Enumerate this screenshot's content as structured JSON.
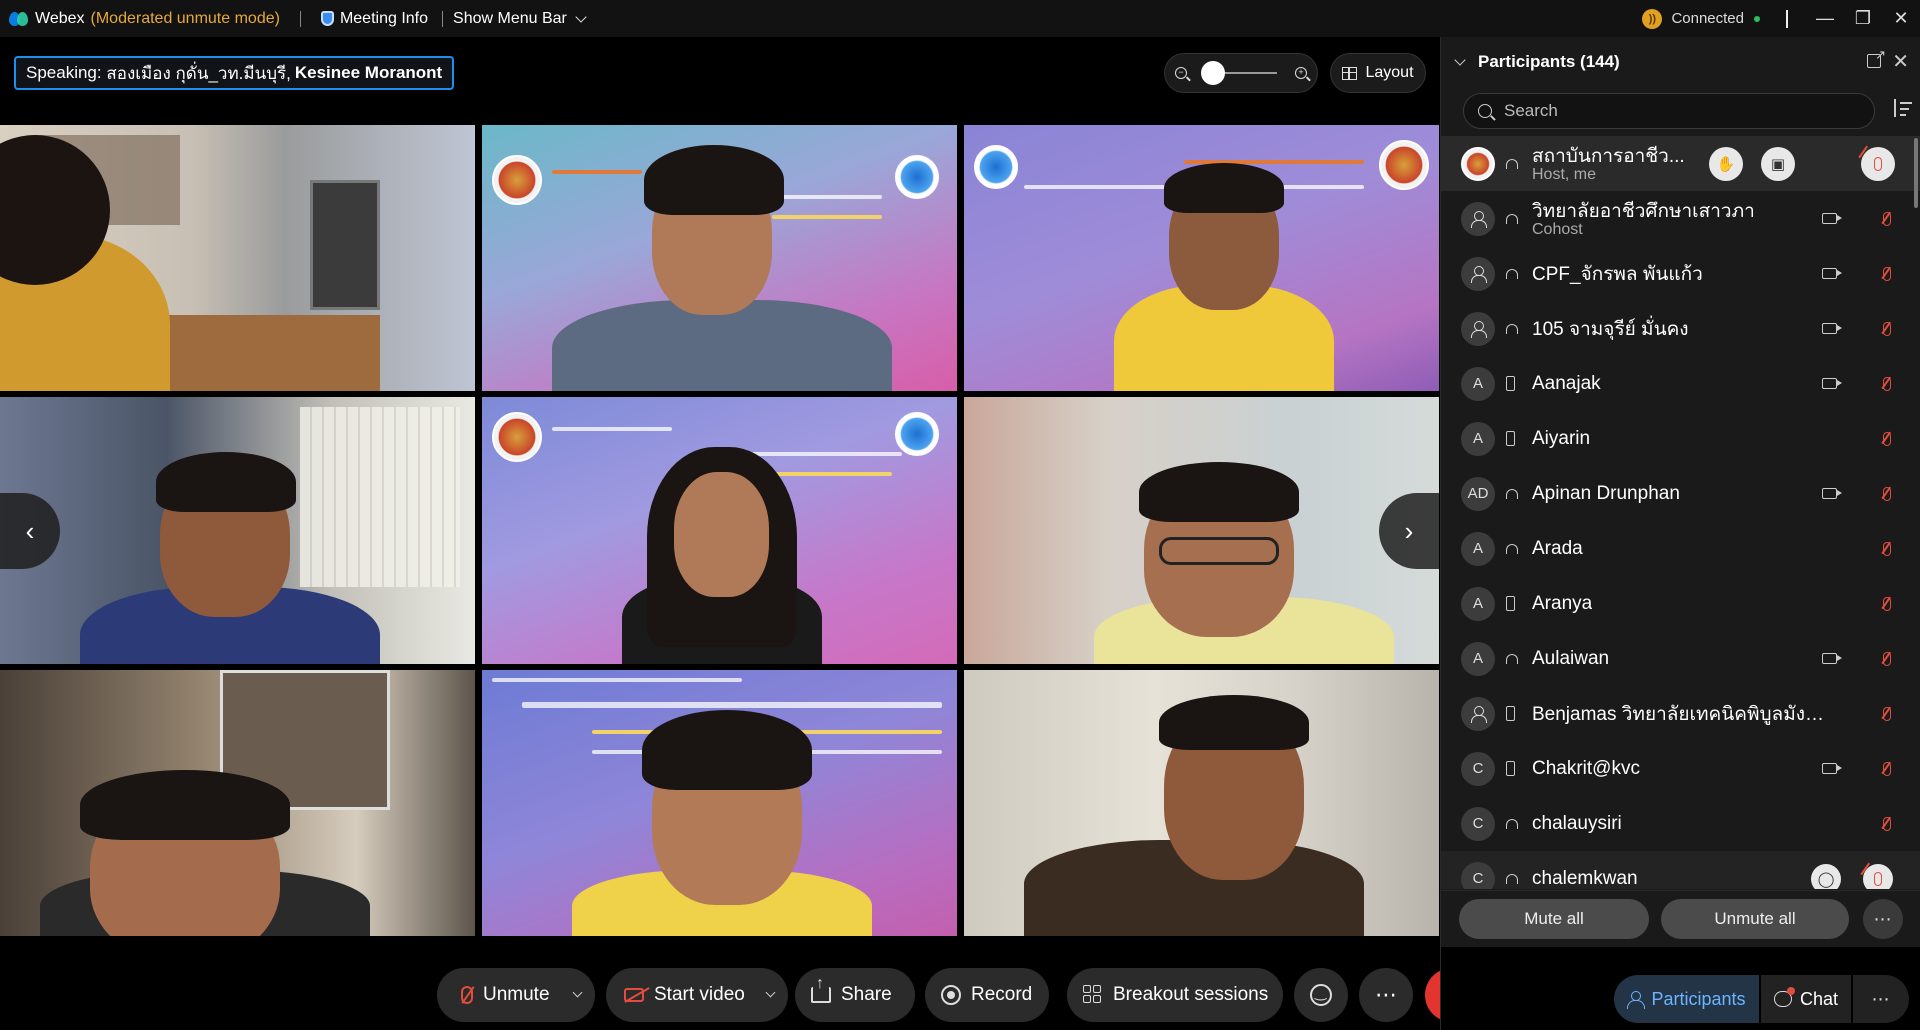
{
  "titlebar": {
    "app_name": "Webex",
    "mode": "(Moderated unmute mode)",
    "meeting_info": "Meeting Info",
    "menu_bar": "Show Menu Bar",
    "status": "Connected",
    "accent": "#e5a93b"
  },
  "speaking": {
    "prefix": "Speaking:",
    "names": "สองเมือง กุดั่น_วท.มีนบุรี,",
    "bold_name": "Kesinee Moranont"
  },
  "layout_button": "Layout",
  "controls": {
    "unmute": "Unmute",
    "start_video": "Start video",
    "share": "Share",
    "record": "Record",
    "breakout": "Breakout sessions",
    "more": "⋯",
    "leave": "✕"
  },
  "participants": {
    "title": "Participants (144)",
    "search_placeholder": "Search",
    "rows": [
      {
        "name": "สถาบันการอาชีว...",
        "role": "Host, me",
        "avatar": ""
      },
      {
        "name": "วิทยาลัยอาชีวศึกษาเสาวภา",
        "role": "Cohost",
        "avatar": ""
      },
      {
        "name": "CPF_จักรพล พันแก้ว",
        "role": "",
        "avatar": ""
      },
      {
        "name": "105 จามจุรีย์ มั่นคง",
        "role": "",
        "avatar": ""
      },
      {
        "name": "Aanajak",
        "role": "",
        "avatar": "A"
      },
      {
        "name": "Aiyarin",
        "role": "",
        "avatar": "A"
      },
      {
        "name": "Apinan Drunphan",
        "role": "",
        "avatar": "AD"
      },
      {
        "name": "Arada",
        "role": "",
        "avatar": "A"
      },
      {
        "name": "Aranya",
        "role": "",
        "avatar": "A"
      },
      {
        "name": "Aulaiwan",
        "role": "",
        "avatar": "A"
      },
      {
        "name": "Benjamas วิทยาลัยเทคนิคพิบูลมังสา...",
        "role": "",
        "avatar": ""
      },
      {
        "name": "Chakrit@kvc",
        "role": "",
        "avatar": "C"
      },
      {
        "name": "chalauysiri",
        "role": "",
        "avatar": "C"
      },
      {
        "name": "chalemkwan",
        "role": "",
        "avatar": "C"
      }
    ],
    "mute_all": "Mute all",
    "unmute_all": "Unmute all",
    "more": "⋯"
  },
  "tabs": {
    "participants": "Participants",
    "chat": "Chat",
    "more": "⋯"
  }
}
